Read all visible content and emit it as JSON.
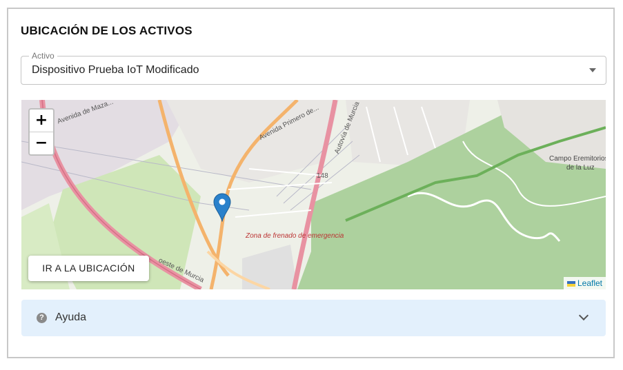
{
  "section": {
    "title": "UBICACIÓN DE LOS ACTIVOS"
  },
  "asset_select": {
    "legend": "Activo",
    "value": "Dispositivo Prueba IoT Modificado"
  },
  "map": {
    "zoom_in": "+",
    "zoom_out": "−",
    "goto_button": "IR A LA UBICACIÓN",
    "attribution": "Leaflet",
    "labels": {
      "avenida_mazarredo": "Avenida de Maza...",
      "avenida_primero": "Avenida Primero de...",
      "autovia_murcia": "Autovía de Murcia",
      "road_148": "148",
      "campo_eremitorios": "Campo Eremitorios",
      "de_la_luz": "de la Luz",
      "zona_frenado": "Zona de frenado de emergencia",
      "oeste_murcia": "oeste de Murcia"
    },
    "colors": {
      "park": "#cde9b6",
      "forest": "#add19e",
      "highway": "#e892a2",
      "primary": "#fcd6a4",
      "marker": "#2a81cb"
    }
  },
  "help": {
    "label": "Ayuda",
    "icon": "question-circle-icon"
  }
}
